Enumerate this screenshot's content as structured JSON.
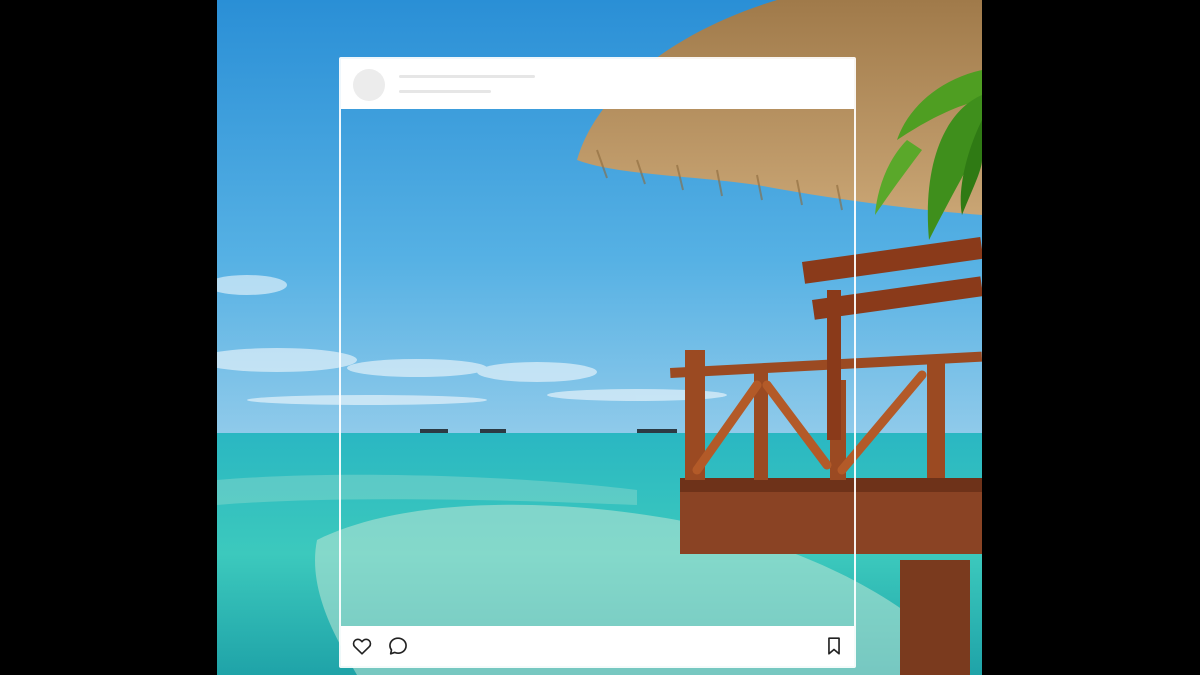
{
  "post": {
    "actions": [
      {
        "icon": "heart-icon"
      },
      {
        "icon": "comment-icon"
      },
      {
        "icon": "bookmark-icon"
      }
    ]
  },
  "colors": {
    "background": "#000000",
    "sky": "#3a9fdc",
    "sea": "#2ec0bf",
    "frame": "#ffffff",
    "wood": "#8a3f22",
    "thatch": "#b58a55",
    "leaf": "#3f8f1c"
  }
}
